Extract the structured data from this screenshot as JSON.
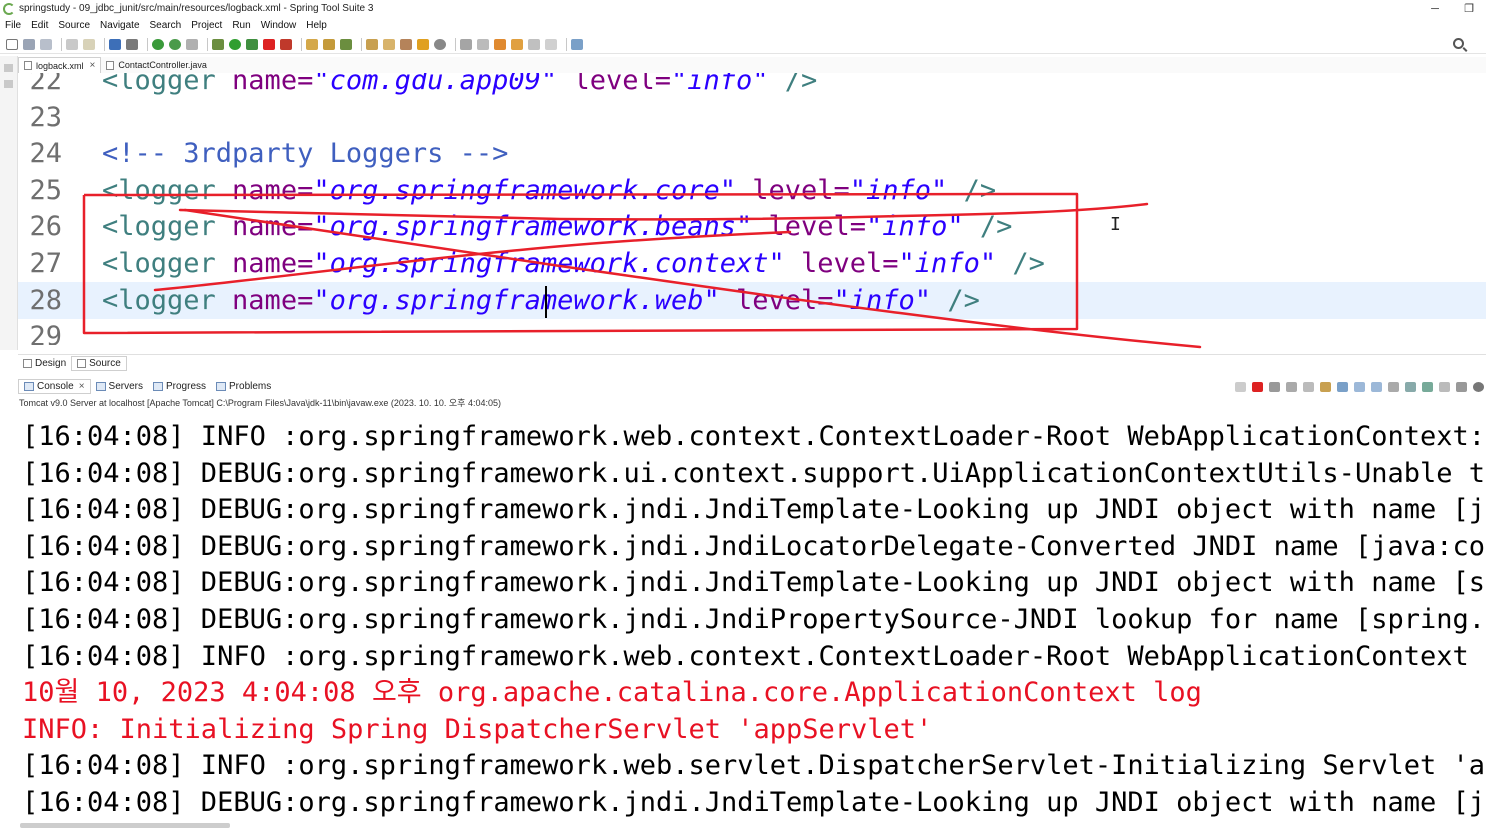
{
  "window": {
    "title": "springstudy - 09_jdbc_junit/src/main/resources/logback.xml - Spring Tool Suite 3",
    "minimize_glyph": "─",
    "restore_glyph": "❐"
  },
  "menu": [
    "File",
    "Edit",
    "Source",
    "Navigate",
    "Search",
    "Project",
    "Run",
    "Window",
    "Help"
  ],
  "editor_tabs": [
    {
      "label": "logback.xml",
      "active": true,
      "close": "×"
    },
    {
      "label": "ContactController.java",
      "active": false
    }
  ],
  "code": {
    "lines": [
      {
        "num": "22",
        "segments": [
          [
            "tag",
            "<logger "
          ],
          [
            "attr",
            "name="
          ],
          [
            "str",
            "\"com.gdu.app09\""
          ],
          [
            "plain",
            " "
          ],
          [
            "attr",
            "level="
          ],
          [
            "str",
            "\"info\""
          ],
          [
            "plain",
            " "
          ],
          [
            "tag",
            "/>"
          ]
        ]
      },
      {
        "num": "23",
        "segments": []
      },
      {
        "num": "24",
        "segments": [
          [
            "comment",
            "<!-- 3rdparty Loggers -->"
          ]
        ]
      },
      {
        "num": "25",
        "segments": [
          [
            "tag",
            "<logger "
          ],
          [
            "attr",
            "name="
          ],
          [
            "str",
            "\"org.springframework.core\""
          ],
          [
            "plain",
            " "
          ],
          [
            "attr",
            "level="
          ],
          [
            "str",
            "\"info\""
          ],
          [
            "plain",
            " "
          ],
          [
            "tag",
            "/>"
          ]
        ]
      },
      {
        "num": "26",
        "segments": [
          [
            "tag",
            "<logger "
          ],
          [
            "attr",
            "name="
          ],
          [
            "str",
            "\"org.springframework.beans\""
          ],
          [
            "plain",
            " "
          ],
          [
            "attr",
            "level="
          ],
          [
            "str",
            "\"info\""
          ],
          [
            "plain",
            " "
          ],
          [
            "tag",
            "/>"
          ]
        ]
      },
      {
        "num": "27",
        "segments": [
          [
            "tag",
            "<logger "
          ],
          [
            "attr",
            "name="
          ],
          [
            "str",
            "\"org.springframework.context\""
          ],
          [
            "plain",
            " "
          ],
          [
            "attr",
            "level="
          ],
          [
            "str",
            "\"info\""
          ],
          [
            "plain",
            " "
          ],
          [
            "tag",
            "/>"
          ]
        ]
      },
      {
        "num": "28",
        "segments": [
          [
            "tag",
            "<logger "
          ],
          [
            "attr",
            "name="
          ],
          [
            "str",
            "\"org.springframework.web\""
          ],
          [
            "plain",
            " "
          ],
          [
            "attr",
            "level="
          ],
          [
            "str",
            "\"info\""
          ],
          [
            "plain",
            " "
          ],
          [
            "tag",
            "/>"
          ]
        ]
      },
      {
        "num": "29",
        "segments": []
      }
    ],
    "current_line": "28"
  },
  "edit_mode_tabs": [
    {
      "label": "Design",
      "active": false
    },
    {
      "label": "Source",
      "active": true
    }
  ],
  "console_tabs": [
    {
      "label": "Console",
      "active": true,
      "close": "×"
    },
    {
      "label": "Servers",
      "active": false
    },
    {
      "label": "Progress",
      "active": false
    },
    {
      "label": "Problems",
      "active": false
    }
  ],
  "console": {
    "process": "Tomcat v9.0 Server at localhost [Apache Tomcat] C:\\Program Files\\Java\\jdk-11\\bin\\javaw.exe  (2023. 10. 10. 오후 4:04:05)",
    "lines": [
      {
        "text": "[16:04:08] INFO :org.springframework.web.context.ContextLoader-Root WebApplicationContext: in",
        "error": false
      },
      {
        "text": "[16:04:08] DEBUG:org.springframework.ui.context.support.UiApplicationContextUtils-Unable to",
        "error": false
      },
      {
        "text": "[16:04:08] DEBUG:org.springframework.jndi.JndiTemplate-Looking up JNDI object with name [java",
        "error": false
      },
      {
        "text": "[16:04:08] DEBUG:org.springframework.jndi.JndiLocatorDelegate-Converted JNDI name [java:comp",
        "error": false
      },
      {
        "text": "[16:04:08] DEBUG:org.springframework.jndi.JndiTemplate-Looking up JNDI object with name [spr",
        "error": false
      },
      {
        "text": "[16:04:08] DEBUG:org.springframework.jndi.JndiPropertySource-JNDI lookup for name [spring.li",
        "error": false
      },
      {
        "text": "[16:04:08] INFO :org.springframework.web.context.ContextLoader-Root WebApplicationContext in",
        "error": false
      },
      {
        "text": "10월 10, 2023 4:04:08 오후 org.apache.catalina.core.ApplicationContext log",
        "error": true
      },
      {
        "text": "INFO: Initializing Spring DispatcherServlet 'appServlet'",
        "error": true
      },
      {
        "text": "[16:04:08] INFO :org.springframework.web.servlet.DispatcherServlet-Initializing Servlet 'app",
        "error": false
      },
      {
        "text": "[16:04:08] DEBUG:org.springframework.jndi.JndiTemplate-Looking up JNDI object with name [java",
        "error": false
      }
    ]
  },
  "colors": {
    "xml_tag": "#3f7f7f",
    "xml_attr": "#7f007f",
    "xml_string": "#2a00ff",
    "xml_comment": "#3f5fbf",
    "console_error": "#e81123",
    "annotation": "#e8202a",
    "current_line": "#e8f2fe"
  },
  "icons": [
    "spring-app-icon",
    "search-icon",
    "file-icon",
    "console-icon"
  ]
}
